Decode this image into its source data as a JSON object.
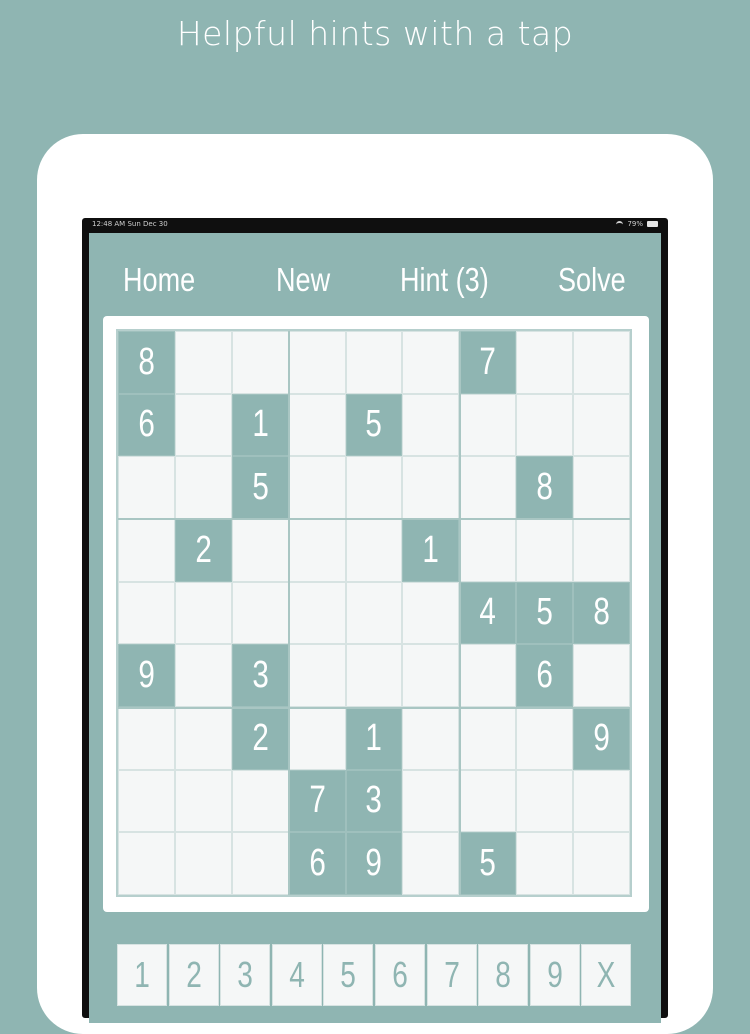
{
  "headline": "Helpful hints with a tap",
  "status_bar": {
    "time": "12:48 AM  Sun Dec 30",
    "battery": "79%"
  },
  "toolbar": {
    "home_label": "Home",
    "new_label": "New",
    "hint_label": "Hint (3)",
    "solve_label": "Solve"
  },
  "colors": {
    "background": "#8fb5b2",
    "given_cell": "#8fb5b2",
    "empty_cell": "#f5f7f7"
  },
  "board": {
    "rows": [
      [
        "8",
        "",
        "",
        "",
        "",
        "",
        "7",
        "",
        ""
      ],
      [
        "6",
        "",
        "1",
        "",
        "5",
        "",
        "",
        "",
        ""
      ],
      [
        "",
        "",
        "5",
        "",
        "",
        "",
        "",
        "8",
        ""
      ],
      [
        "",
        "2",
        "",
        "",
        "",
        "1",
        "",
        "",
        ""
      ],
      [
        "",
        "",
        "",
        "",
        "",
        "",
        "4",
        "5",
        "8"
      ],
      [
        "9",
        "",
        "3",
        "",
        "",
        "",
        "",
        "6",
        ""
      ],
      [
        "",
        "",
        "2",
        "",
        "1",
        "",
        "",
        "",
        "9"
      ],
      [
        "",
        "",
        "",
        "7",
        "3",
        "",
        "",
        "",
        ""
      ],
      [
        "",
        "",
        "",
        "6",
        "9",
        "",
        "5",
        "",
        ""
      ]
    ]
  },
  "keypad": {
    "keys": [
      "1",
      "2",
      "3",
      "4",
      "5",
      "6",
      "7",
      "8",
      "9",
      "X"
    ]
  }
}
